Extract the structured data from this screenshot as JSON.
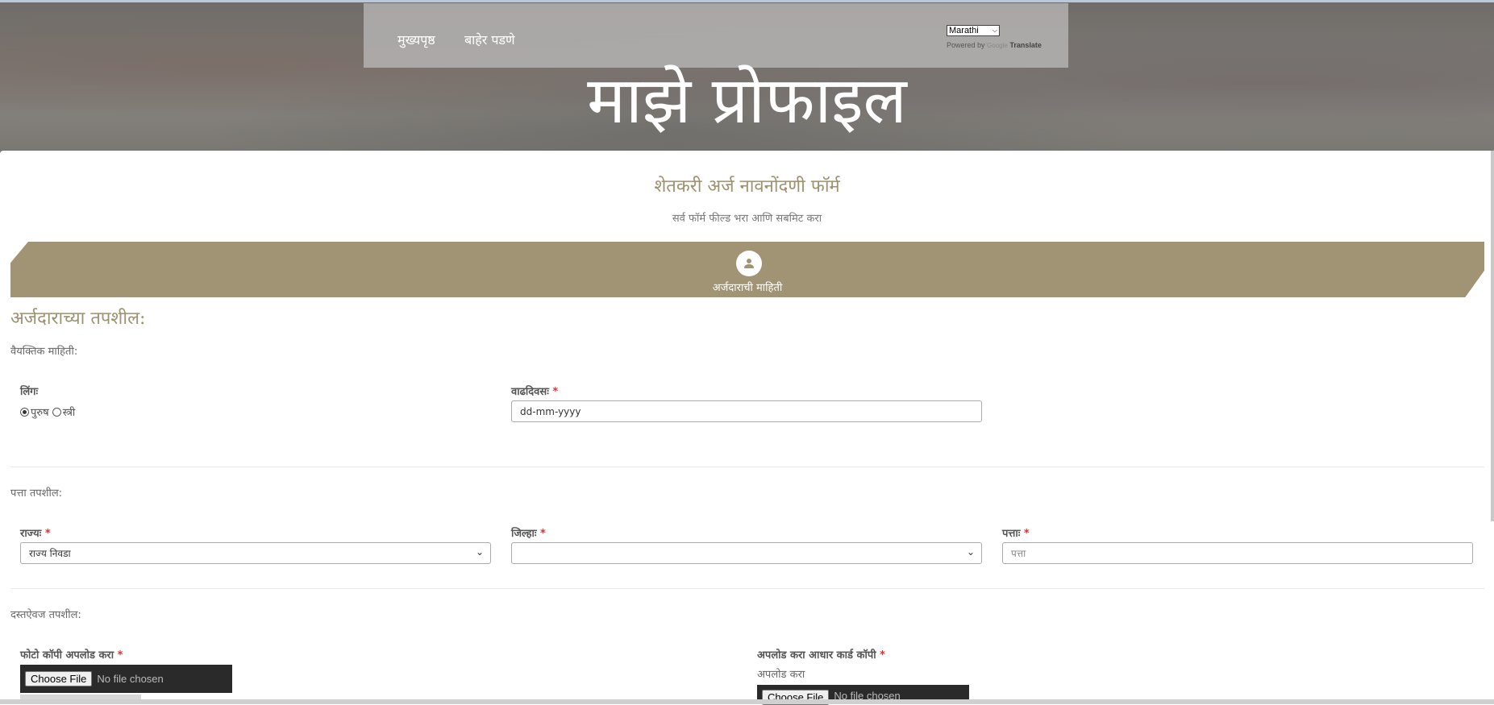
{
  "nav": {
    "home": "मुख्यपृष्ठ",
    "logout": "बाहेर पडणे"
  },
  "translate": {
    "selected_language": "Marathi",
    "powered_prefix": "Powered by",
    "google": "Google",
    "translate_word": "Translate"
  },
  "hero": {
    "title": "माझे प्रोफाइल"
  },
  "form": {
    "title": "शेतकरी अर्ज नावनोंदणी फॉर्म",
    "subtitle": "सर्व फॉर्म फील्ड भरा आणि सबमिट करा"
  },
  "step": {
    "label": "अर्जदाराची माहिती",
    "icon": "user-icon"
  },
  "applicant": {
    "heading": "अर्जदाराच्या तपशील:",
    "personal_heading": "वैयक्तिक माहिती:",
    "gender_label": "लिंगः",
    "gender_options": [
      "पुरुष",
      "स्त्री"
    ],
    "gender_selected": "पुरुष",
    "dob_label": "वाढदिवसः",
    "dob_placeholder": "dd-mm-yyyy"
  },
  "address": {
    "heading": "पत्ता तपशील:",
    "state_label": "राज्यः",
    "state_value": "राज्य निवडा",
    "district_label": "जिल्हाः",
    "district_value": "",
    "address_label": "पत्ताः",
    "address_placeholder": "पत्ता"
  },
  "documents": {
    "heading": "दस्तऐवज तपशील:",
    "photo_label": "फोटो कॉपी अपलोड करा",
    "aadhaar_label": "अपलोड करा आधार कार्ड कॉपी",
    "aadhaar_hint": "अपलोड करा",
    "choose_file": "Choose File",
    "no_file": "No file chosen"
  },
  "required_mark": "*",
  "colors": {
    "accent": "#a09475",
    "accent_text": "#9d916f",
    "required": "#e03030"
  }
}
